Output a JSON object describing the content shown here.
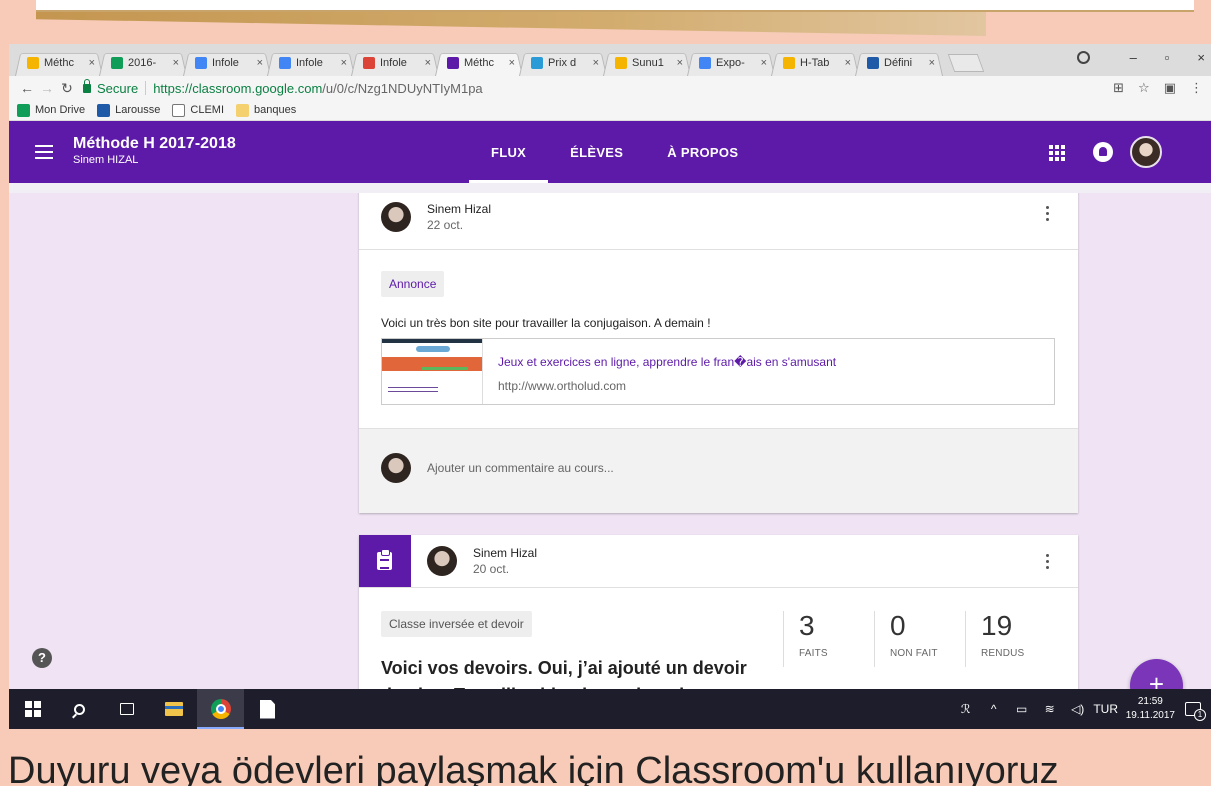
{
  "browser": {
    "tabs": [
      {
        "title": "Méthc",
        "fav_color": "#f4b400"
      },
      {
        "title": "2016-",
        "fav_color": "#0f9d58"
      },
      {
        "title": "Infole",
        "fav_color": "#4285f4"
      },
      {
        "title": "Infole",
        "fav_color": "#4285f4"
      },
      {
        "title": "Infole",
        "fav_color": "#db4437"
      },
      {
        "title": "Méthc",
        "fav_color": "#5d1aa8"
      },
      {
        "title": "Prix d",
        "fav_color": "#2a9bd6"
      },
      {
        "title": "Sunu1",
        "fav_color": "#f4b400"
      },
      {
        "title": "Expo-",
        "fav_color": "#4285f4"
      },
      {
        "title": "H-Tab",
        "fav_color": "#f4b400"
      },
      {
        "title": "Défini",
        "fav_color": "#1e5aa8"
      }
    ],
    "tab_close": "×",
    "window_controls": {
      "minimize": "–",
      "maximize": "▫",
      "close": "×"
    },
    "secure_label": "Secure",
    "url_base": "https://classroom.google.com",
    "url_rest": "/u/0/c/Nzg1NDUyNTIyM1pa",
    "bookmarks": [
      {
        "label": "Mon Drive",
        "color": "#0f9d58"
      },
      {
        "label": "Larousse",
        "color": "#1e5aa8"
      },
      {
        "label": "CLEMI",
        "color": "#ffffff"
      },
      {
        "label": "banques",
        "color": "#f4d06f"
      }
    ]
  },
  "classroom": {
    "class_title": "Méthode H 2017-2018",
    "class_subtitle": "Sinem HIZAL",
    "nav": [
      "FLUX",
      "ÉLÈVES",
      "À PROPOS"
    ],
    "active_nav": "FLUX",
    "accent_color": "#5d1aa8"
  },
  "post1": {
    "author": "Sinem Hizal",
    "date": "22 oct.",
    "badge": "Annonce",
    "text": "Voici un très bon site pour travailler la conjugaison. A demain !",
    "link_title": "Jeux et exercices en ligne, apprendre le fran�ais en s'amusant",
    "link_url": "http://www.ortholud.com",
    "comment_placeholder": "Ajouter un commentaire au cours..."
  },
  "post2": {
    "author": "Sinem Hizal",
    "date": "20 oct.",
    "badge": "Classe inversée et devoir",
    "title": "Voici vos devoirs. Oui, j’ai ajouté un devoir de plus. Travaillez bien le week-end",
    "stats": [
      {
        "value": "3",
        "label": "FAITS"
      },
      {
        "value": "0",
        "label": "NON FAIT"
      },
      {
        "value": "19",
        "label": "RENDUS"
      }
    ]
  },
  "fab_label": "+",
  "help_label": "?",
  "taskbar": {
    "language": "TUR",
    "time": "21:59",
    "date": "19.11.2017",
    "notification_count": "1"
  },
  "caption": "Duyuru veya ödevleri paylaşmak için Classroom'u kullanıyoruz"
}
